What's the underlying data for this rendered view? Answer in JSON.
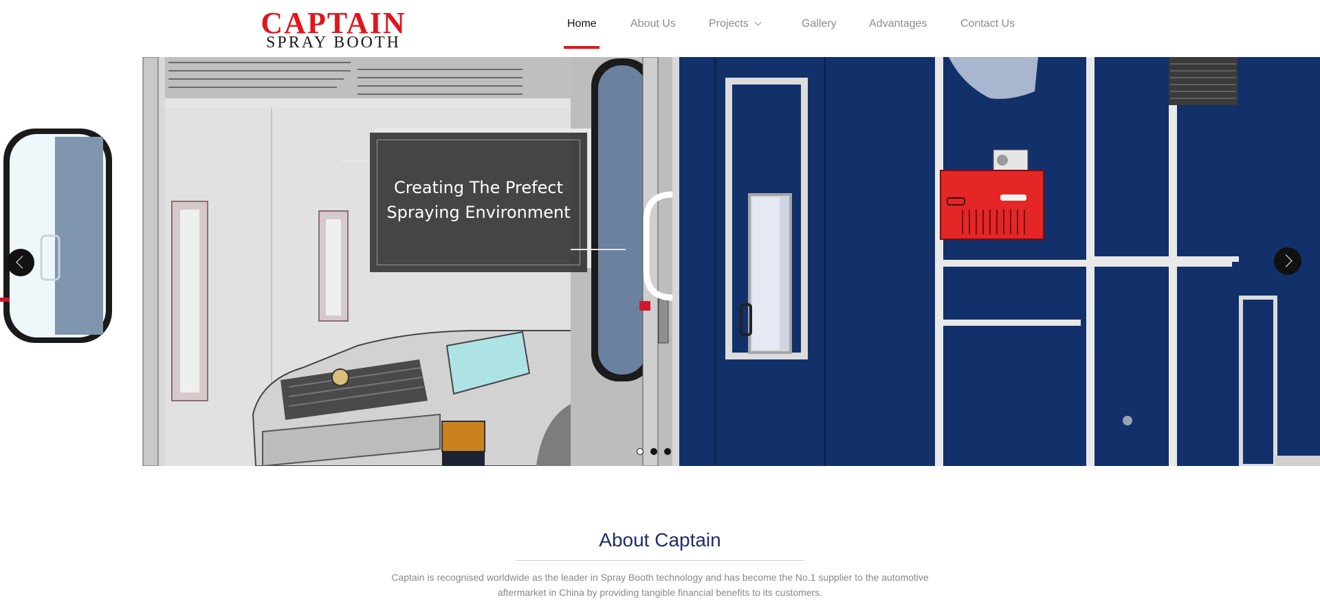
{
  "logo": {
    "main": "CAPTAIN",
    "sub": "SPRAY BOOTH"
  },
  "nav": {
    "items": [
      {
        "label": "Home",
        "active": true
      },
      {
        "label": "About Us"
      },
      {
        "label": "Projects",
        "has_dropdown": true
      },
      {
        "label": "Gallery"
      },
      {
        "label": "Advantages"
      },
      {
        "label": "Contact Us"
      }
    ]
  },
  "hero": {
    "caption": [
      "Creating The Prefect",
      "Spraying Environment"
    ],
    "slides_count": 3,
    "active_slide": 1,
    "prev_icon": "chevron-left-icon",
    "next_icon": "chevron-right-icon"
  },
  "about": {
    "title": "About Captain",
    "text": "Captain is recognised worldwide as the leader in Spray Booth technology and has become the No.1 supplier to the automotive aftermarket in China by providing tangible financial benefits to its customers."
  },
  "colors": {
    "brand_red": "#e3141b",
    "booth_blue": "#12306a",
    "title_blue": "#1d2c6b"
  }
}
